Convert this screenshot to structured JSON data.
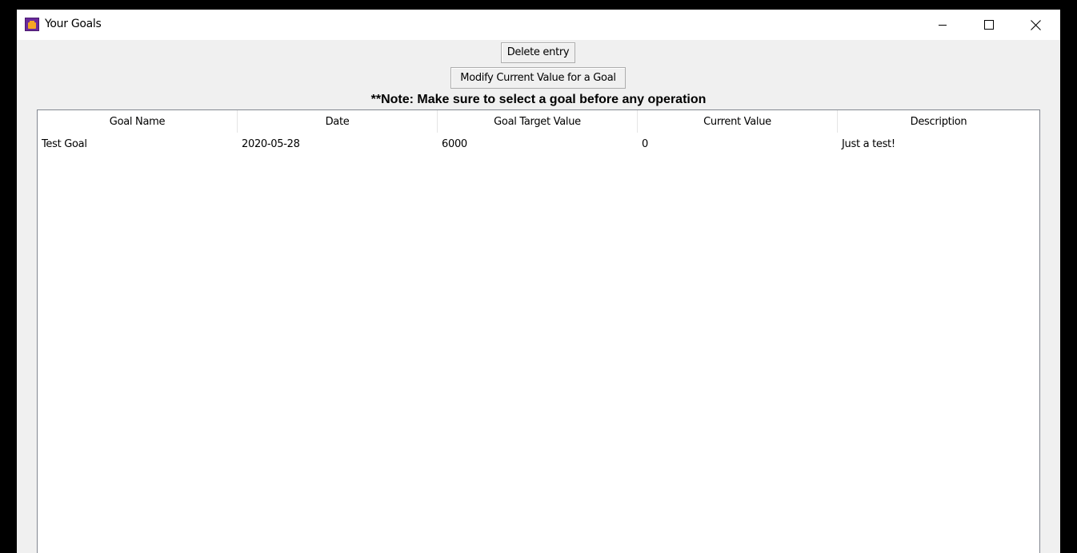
{
  "window": {
    "title": "Your Goals"
  },
  "toolbar": {
    "delete_label": "Delete entry",
    "modify_label": "Modify Current Value for a Goal"
  },
  "note": "**Note: Make sure to select a goal before any operation",
  "table": {
    "columns": [
      "Goal Name",
      "Date",
      "Goal Target Value",
      "Current Value",
      "Description"
    ],
    "rows": [
      [
        "Test Goal",
        "2020-05-28",
        "6000",
        "0",
        "Just a test!"
      ]
    ]
  },
  "icons": {
    "app": "goals-app-icon",
    "minimize": "minimize-icon",
    "maximize": "maximize-icon",
    "close": "close-icon"
  },
  "colors": {
    "window_bg": "#f0f0f0",
    "titlebar_bg": "#ffffff",
    "table_bg": "#ffffff",
    "app_icon": "#6a2a9c",
    "app_icon_accent": "#f5a623"
  }
}
